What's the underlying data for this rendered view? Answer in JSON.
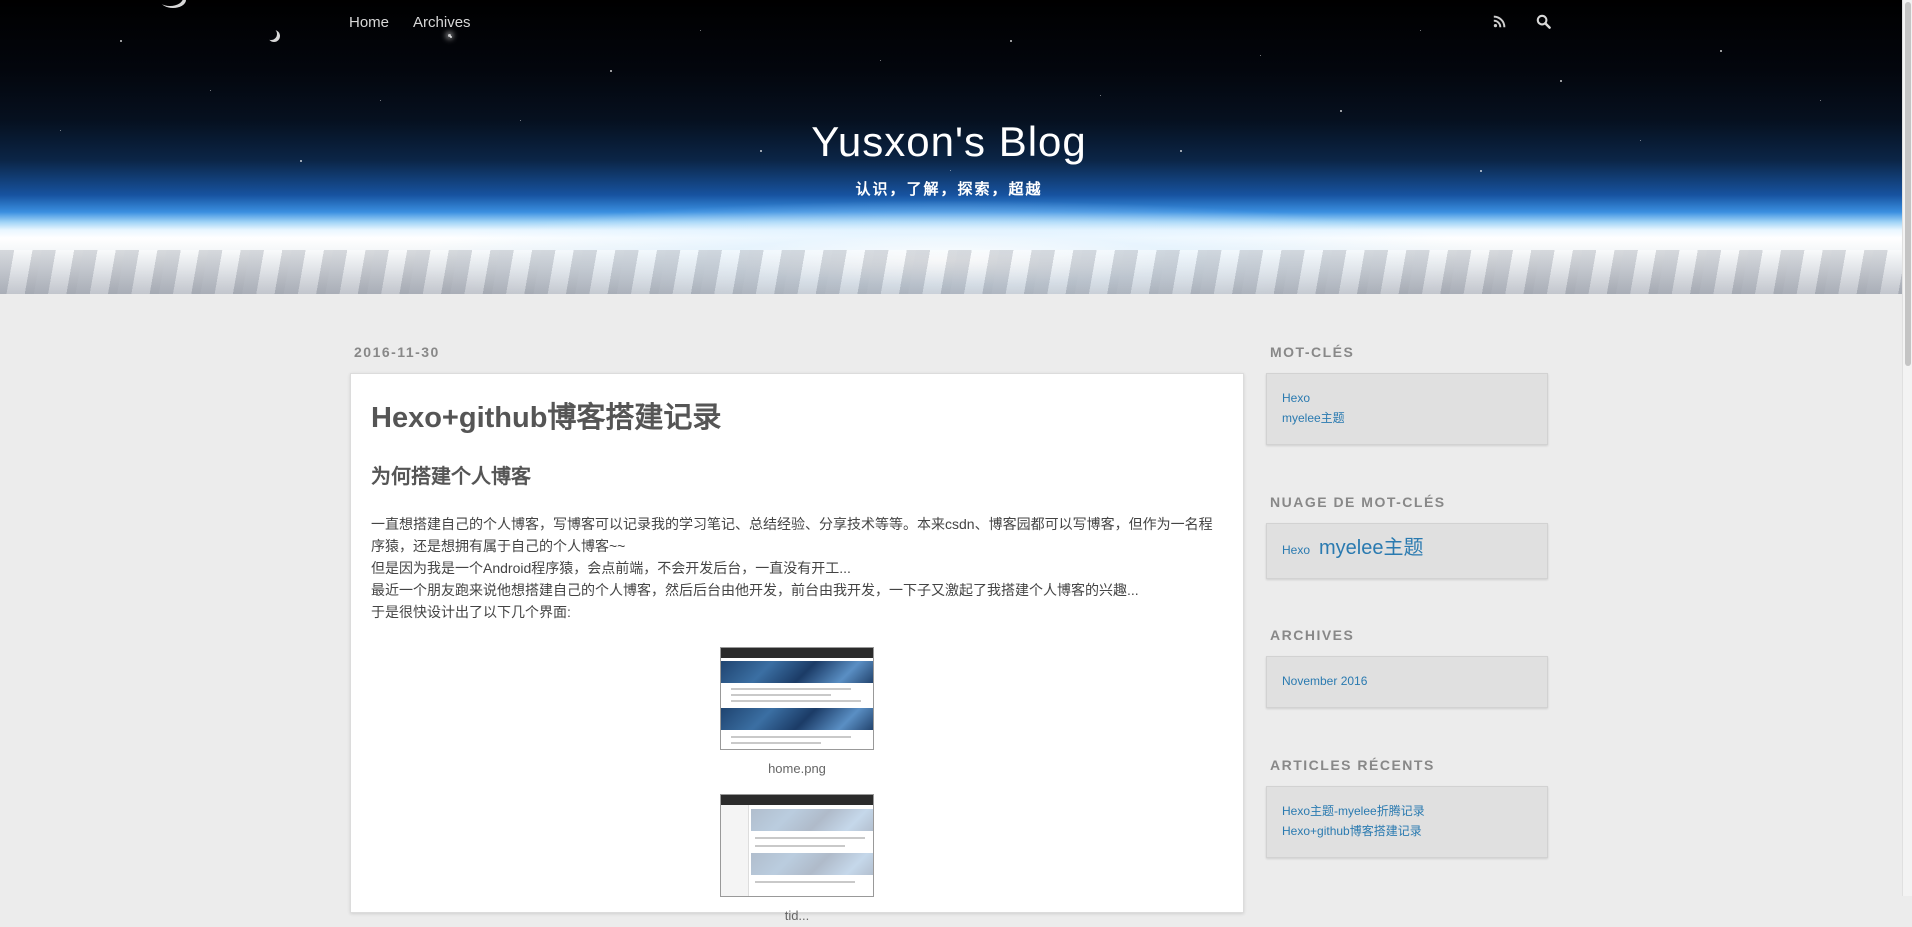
{
  "nav": {
    "home": "Home",
    "archives": "Archives",
    "rss_icon": "rss-icon",
    "search_icon": "search-icon"
  },
  "site": {
    "title": "Yusxon's Blog",
    "subtitle": "认识，了解，探索，超越"
  },
  "post": {
    "date": "2016-11-30",
    "title": "Hexo+github博客搭建记录",
    "section_heading": "为何搭建个人博客",
    "paragraphs": [
      "一直想搭建自己的个人博客，写博客可以记录我的学习笔记、总结经验、分享技术等等。本来csdn、博客园都可以写博客，但作为一名程序猿，还是想拥有属于自己的个人博客~~",
      "但是因为我是一个Android程序猿，会点前端，不会开发后台，一直没有开工...",
      "最近一个朋友跑来说他想搭建自己的个人博客，然后后台由他开发，前台由我开发，一下子又激起了我搭建个人博客的兴趣...",
      "于是很快设计出了以下几个界面:"
    ],
    "figures": [
      {
        "caption": "home.png"
      },
      {
        "caption": "tid..."
      }
    ]
  },
  "sidebar": {
    "tags_title": "MOT-CLÉS",
    "tags": [
      "Hexo",
      "myelee主题"
    ],
    "tagcloud_title": "NUAGE DE MOT-CLÉS",
    "tagcloud": [
      {
        "label": "Hexo",
        "weight": "small"
      },
      {
        "label": "myelee主题",
        "weight": "big"
      }
    ],
    "archives_title": "ARCHIVES",
    "archives": [
      "November 2016"
    ],
    "recent_title": "ARTICLES RÉCENTS",
    "recent": [
      "Hexo主题-myelee折腾记录",
      "Hexo+github博客搭建记录"
    ]
  },
  "colors": {
    "link": "#2a7ab0",
    "page_bg": "#ececec",
    "widget_bg": "#e0e0e0"
  }
}
